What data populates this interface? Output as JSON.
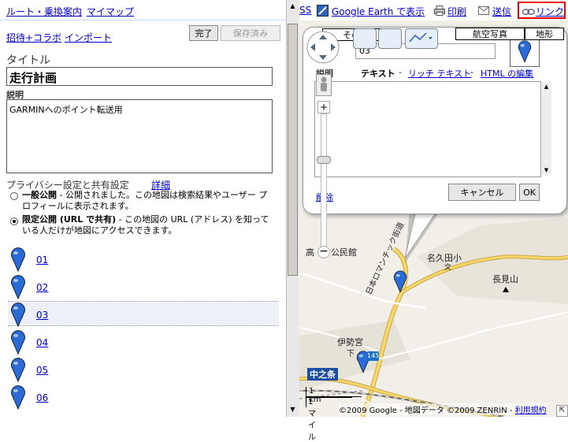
{
  "topbar": {
    "route_link": "ルート・乗換案内",
    "mymaps_link": "マイマップ",
    "collapse_arrows": "«",
    "rss_fragment": "SS",
    "earth_link": "Google Earth で表示",
    "print_link": "印刷",
    "send_link": "送信",
    "link_link": "リンク"
  },
  "leftpanel": {
    "invite_link": "招待+コラボ",
    "import_link": "インポート",
    "done_button": "完了",
    "saved_button": "保存済み",
    "title_label": "タイトル",
    "title_value": "走行計画",
    "description_label": "説明",
    "description_value": "GARMINへのポイント転送用",
    "privacy_label": "プライバシー設定と共有設定",
    "details_link": "詳細",
    "public_option_bold": "一般公開",
    "public_option_text": " - 公開されました。この地図は検索結果やユーザー プロフィールに表示されます。",
    "unlisted_option_bold": "限定公開 (URL で共有)",
    "unlisted_option_text": " - この地図の URL (アドレス) を知っている人だけが地図にアクセスできます。",
    "selected_option": "unlisted",
    "placemarks": [
      {
        "label": "01"
      },
      {
        "label": "02"
      },
      {
        "label": "03",
        "selected": true
      },
      {
        "label": "04"
      },
      {
        "label": "05"
      },
      {
        "label": "06"
      }
    ]
  },
  "map": {
    "map_types": {
      "more": "その他...",
      "satellite": "航空写真",
      "terrain": "地形"
    },
    "labels": {
      "kominkan": "高",
      "kominkan_rest": "公民館",
      "nakutaogo": "名久田小",
      "bun1": "文",
      "nagamiyama": "長見山",
      "route_name": "日本ロマンチック街道",
      "isemiya": "伊勢宮",
      "isemiya_sub": "下",
      "nakanojo": "中之条",
      "route_badge": "145",
      "scale_km": "1 km",
      "scale_mile": "1 マイル",
      "copyright": "©2009 Google - 地図データ ©2009 ZENRIN - ",
      "terms_link": "利用規約"
    }
  },
  "infowindow": {
    "name_value": "03",
    "description_label": "説明",
    "tab_text": "テキスト",
    "tab_rich": "リッチ テキスト",
    "tab_html": "HTML の編集",
    "separator": " - ",
    "delete_link": "削除",
    "cancel_button": "キャンセル",
    "ok_button": "OK"
  },
  "colors": {
    "link": "#0000cc",
    "pin": "#2a6bd8",
    "highlight": "#e00000",
    "road_yellow": "#f7d66a",
    "map_bg": "#f2efe9"
  }
}
